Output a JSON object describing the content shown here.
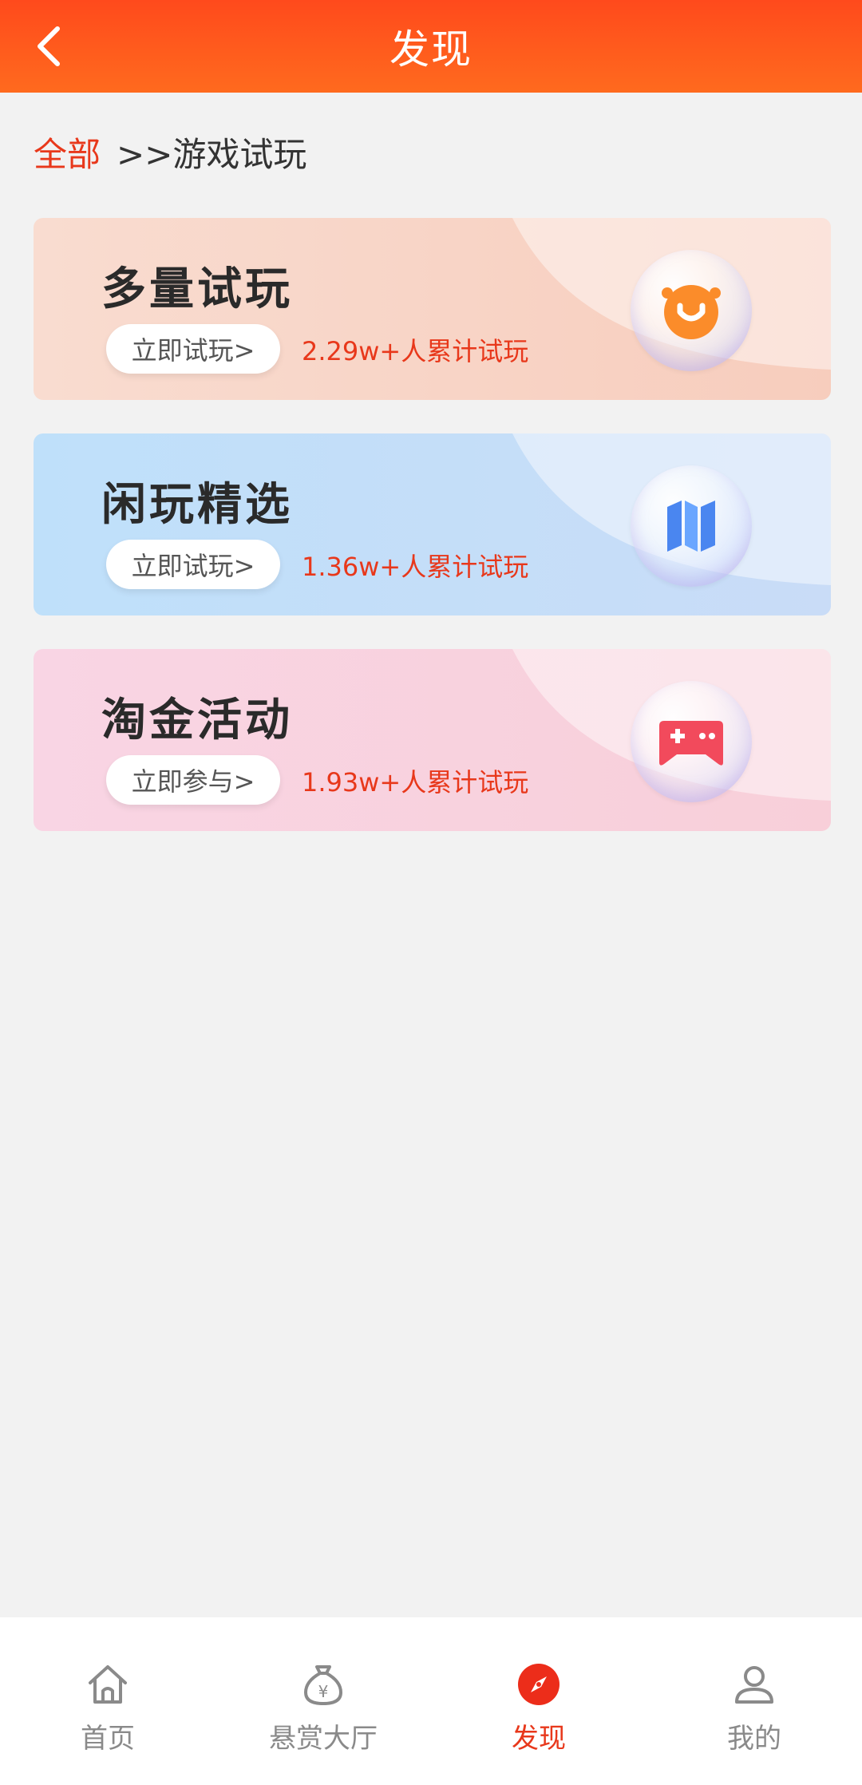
{
  "header": {
    "title": "发现"
  },
  "breadcrumb": {
    "root": "全部",
    "current": ">>游戏试玩"
  },
  "cards": [
    {
      "title": "多量试玩",
      "button_label": "立即试玩>",
      "count_text": "2.29w+人累计试玩",
      "icon": "orange-smile-icon"
    },
    {
      "title": "闲玩精选",
      "button_label": "立即试玩>",
      "count_text": "1.36w+人累计试玩",
      "icon": "blue-map-icon"
    },
    {
      "title": "淘金活动",
      "button_label": "立即参与>",
      "count_text": "1.93w+人累计试玩",
      "icon": "red-gamepad-icon"
    }
  ],
  "bottom_nav": {
    "items": [
      {
        "label": "首页",
        "icon": "home-icon",
        "active": false
      },
      {
        "label": "悬赏大厅",
        "icon": "money-bag-icon",
        "active": false
      },
      {
        "label": "发现",
        "icon": "compass-icon",
        "active": true
      },
      {
        "label": "我的",
        "icon": "user-icon",
        "active": false
      }
    ]
  },
  "colors": {
    "accent": "#e8381b",
    "header_start": "#ff4a1c",
    "header_end": "#ff6a1e",
    "background": "#f2f2f2"
  }
}
